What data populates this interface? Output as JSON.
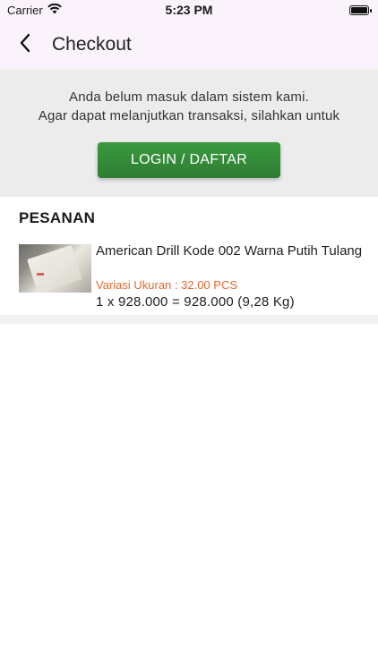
{
  "status_bar": {
    "carrier": "Carrier",
    "time": "5:23 PM",
    "icons": [
      "wifi-icon",
      "battery-icon"
    ]
  },
  "nav": {
    "title": "Checkout",
    "back_icon": "chevron-left-icon"
  },
  "login_panel": {
    "message_line1": "Anda belum masuk dalam sistem kami.",
    "message_line2": "Agar dapat melanjutkan transaksi, silahkan untuk",
    "button_label": "LOGIN / DAFTAR",
    "button_color": "#2e7d32"
  },
  "order": {
    "section_title": "PESANAN",
    "items": [
      {
        "name": "American Drill Kode 002 Warna Putih Tulang",
        "variant": "Variasi Ukuran : 32.00 PCS",
        "total": "1 x 928.000 = 928.000  (9,28 Kg)"
      }
    ]
  },
  "colors": {
    "header_bg": "#fbf3fb",
    "panel_bg": "#ececec",
    "variant_text": "#e06a33"
  }
}
